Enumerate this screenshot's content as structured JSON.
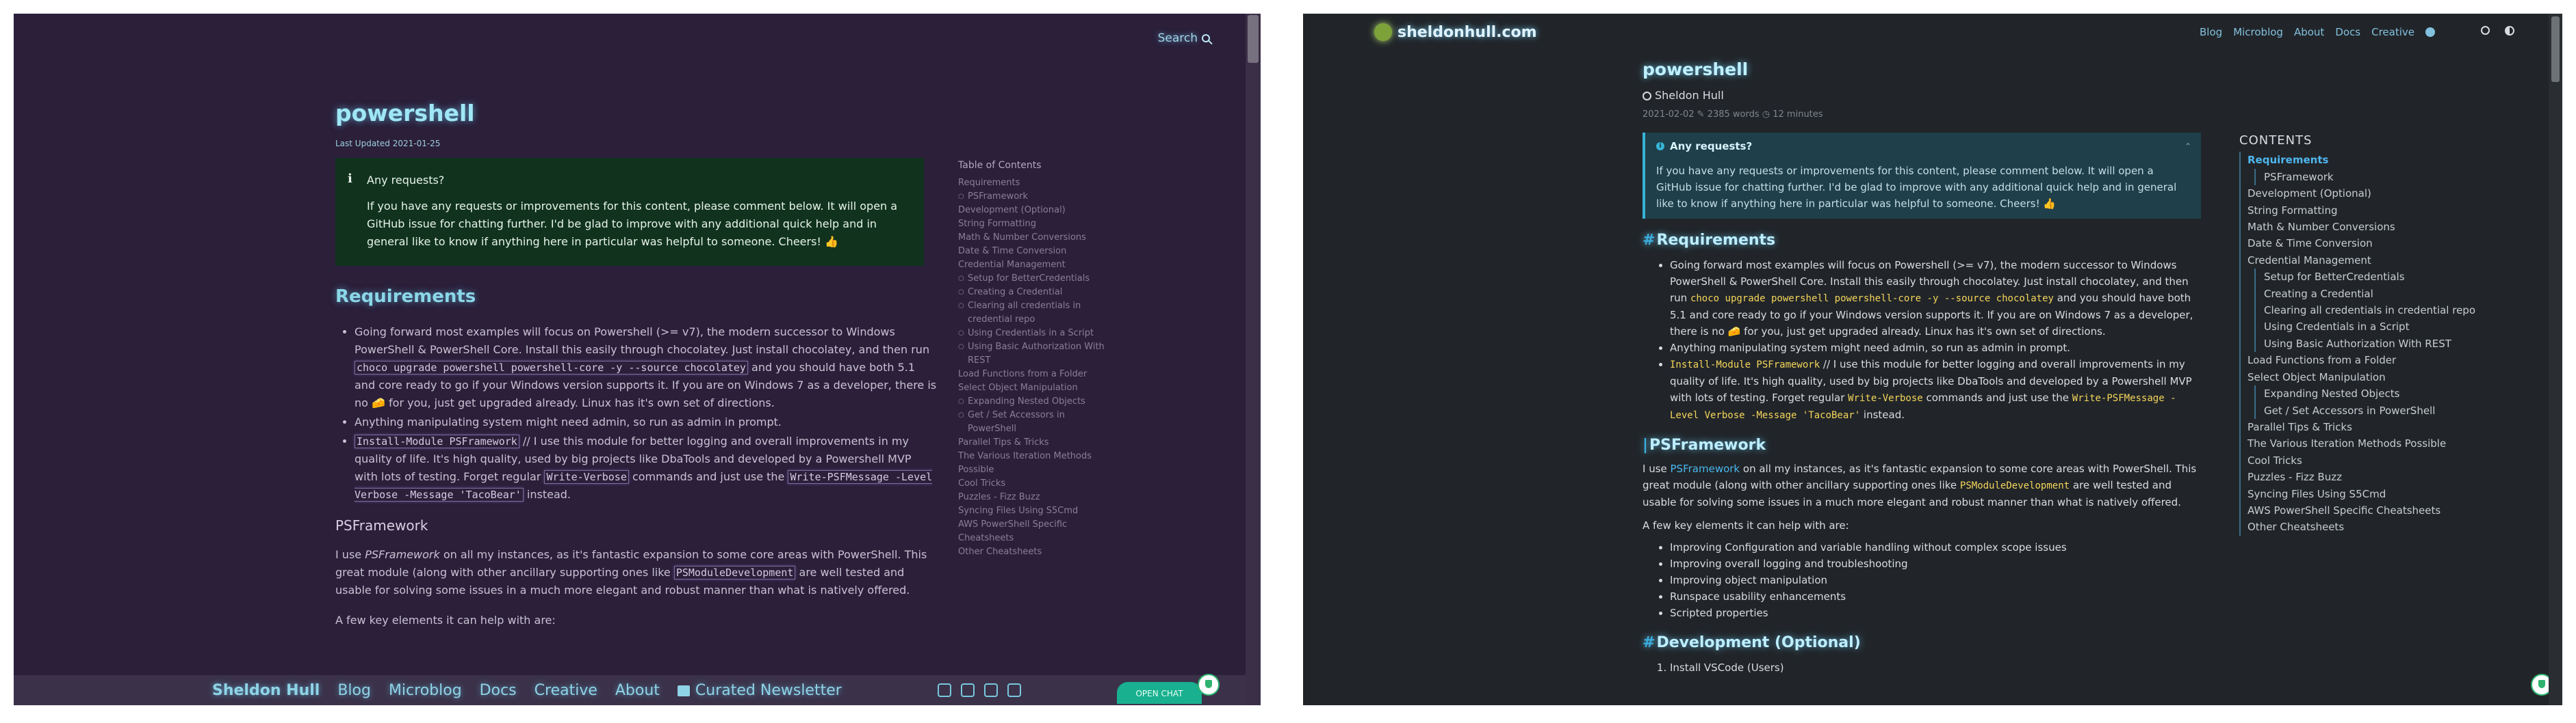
{
  "left": {
    "search_label": "Search",
    "title": "powershell",
    "last_updated": "Last Updated 2021-01-25",
    "callout": {
      "title": "Any requests?",
      "body": "If you have any requests or improvements for this content, please comment below. It will open a GitHub issue for chatting further. I'd be glad to improve with any additional quick help and in general like to know if anything here in particular was helpful to someone. Cheers! 👍"
    },
    "requirements_heading": "Requirements",
    "req1_a": "Going forward most examples will focus on Powershell (>= v7), the modern successor to Windows PowerShell & PowerShell Core. Install this easily through chocolatey. Just install chocolatey, and then run ",
    "req1_code": "choco upgrade powershell powershell-core -y --source chocolatey",
    "req1_b": " and you should have both 5.1 and core ready to go if your Windows version supports it. If you are on Windows 7 as a developer, there is no 🧀 for you, just get upgraded already. Linux has it's own set of directions.",
    "req2": "Anything manipulating system might need admin, so run as admin in prompt.",
    "req3_code": "Install-Module PSFramework",
    "req3_a": " // I use this module for better logging and overall improvements in my quality of life. It's high quality, used by big projects like DbaTools and developed by a Powershell MVP with lots of testing. Forget regular ",
    "req3_code2": "Write-Verbose",
    "req3_b": " commands and just use the ",
    "req3_code3": "Write-PSFMessage -Level Verbose -Message 'TacoBear'",
    "req3_c": " instead.",
    "psf_heading": "PSFramework",
    "psf_a": "I use ",
    "psf_em": "PSFramework",
    "psf_b": " on all my instances, as it's fantastic expansion to some core areas with PowerShell. This great module (along with other ancillary supporting ones like ",
    "psf_code": "PSModuleDevelopment",
    "psf_c": " are well tested and usable for solving some issues in a much more elegant and robust manner than what is natively offered.",
    "few_elements": "A few key elements it can help with are:",
    "toc_title": "Table of Contents",
    "toc": [
      {
        "label": "Requirements",
        "sub": false
      },
      {
        "label": "PSFramework",
        "sub": true
      },
      {
        "label": "Development (Optional)",
        "sub": false
      },
      {
        "label": "String Formatting",
        "sub": false
      },
      {
        "label": "Math & Number Conversions",
        "sub": false
      },
      {
        "label": "Date & Time Conversion",
        "sub": false
      },
      {
        "label": "Credential Management",
        "sub": false
      },
      {
        "label": "Setup for BetterCredentials",
        "sub": true
      },
      {
        "label": "Creating a Credential",
        "sub": true
      },
      {
        "label": "Clearing all credentials in credential repo",
        "sub": true
      },
      {
        "label": "Using Credentials in a Script",
        "sub": true
      },
      {
        "label": "Using Basic Authorization With REST",
        "sub": true
      },
      {
        "label": "Load Functions from a Folder",
        "sub": false
      },
      {
        "label": "Select Object Manipulation",
        "sub": false
      },
      {
        "label": "Expanding Nested Objects",
        "sub": true
      },
      {
        "label": "Get / Set Accessors in PowerShell",
        "sub": true
      },
      {
        "label": "Parallel Tips & Tricks",
        "sub": false
      },
      {
        "label": "The Various Iteration Methods Possible",
        "sub": false
      },
      {
        "label": "Cool Tricks",
        "sub": false
      },
      {
        "label": "Puzzles - Fizz Buzz",
        "sub": false
      },
      {
        "label": "Syncing Files Using S5Cmd",
        "sub": false
      },
      {
        "label": "AWS PowerShell Specific Cheatsheets",
        "sub": false
      },
      {
        "label": "Other Cheatsheets",
        "sub": false
      }
    ],
    "footer": {
      "brand": "Sheldon Hull",
      "links": [
        "Blog",
        "Microblog",
        "Docs",
        "Creative",
        "About"
      ],
      "newsletter": "Curated Newsletter",
      "open_chat": "OPEN CHAT"
    }
  },
  "right": {
    "logo": "sheldonhull.com",
    "nav": [
      "Blog",
      "Microblog",
      "About",
      "Docs",
      "Creative"
    ],
    "title": "powershell",
    "author": "Sheldon Hull",
    "meta": "2021-02-02 ✎ 2385 words  ◷ 12 minutes",
    "callout": {
      "title": "Any requests?",
      "body": "If you have any requests or improvements for this content, please comment below. It will open a GitHub issue for chatting further. I'd be glad to improve with any additional quick help and in general like to know if anything here in particular was helpful to someone. Cheers! 👍"
    },
    "requirements_heading": "Requirements",
    "req1_a": "Going forward most examples will focus on Powershell (>= v7), the modern successor to Windows PowerShell & PowerShell Core. Install this easily through chocolatey. Just install chocolatey, and then run ",
    "req1_code": "choco upgrade powershell powershell-core -y --source chocolatey",
    "req1_b": " and you should have both 5.1 and core ready to go if your Windows version supports it. If you are on Windows 7 as a developer, there is no 🧀 for you, just get upgraded already. Linux has it's own set of directions.",
    "req2": "Anything manipulating system might need admin, so run as admin in prompt.",
    "req3_code": "Install-Module PSFramework",
    "req3_a": " // I use this module for better logging and overall improvements in my quality of life. It's high quality, used by big projects like DbaTools and developed by a Powershell MVP with lots of testing. Forget regular ",
    "req3_code2": "Write-Verbose",
    "req3_b": " commands and just use the ",
    "req3_code3": "Write-PSFMessage -Level Verbose -Message 'TacoBear'",
    "req3_c": " instead.",
    "psf_heading": "PSFramework",
    "psf_a": "I use ",
    "psf_link": "PSFramework",
    "psf_b": " on all my instances, as it's fantastic expansion to some core areas with PowerShell. This great module (along with other ancillary supporting ones like ",
    "psf_code": "PSModuleDevelopment",
    "psf_c": " are well tested and usable for solving some issues in a much more elegant and robust manner than what is natively offered.",
    "few_elements": "A few key elements it can help with are:",
    "elements": [
      "Improving Configuration and variable handling without complex scope issues",
      "Improving overall logging and troubleshooting",
      "Improving object manipulation",
      "Runspace usability enhancements",
      "Scripted properties"
    ],
    "dev_heading": "Development (Optional)",
    "dev_step1": "Install VSCode (Users)",
    "toc_title": "CONTENTS",
    "toc": [
      {
        "label": "Requirements",
        "sub": false,
        "active": true
      },
      {
        "label": "PSFramework",
        "sub": true
      },
      {
        "label": "Development (Optional)",
        "sub": false
      },
      {
        "label": "String Formatting",
        "sub": false
      },
      {
        "label": "Math & Number Conversions",
        "sub": false
      },
      {
        "label": "Date & Time Conversion",
        "sub": false
      },
      {
        "label": "Credential Management",
        "sub": false
      },
      {
        "label": "Setup for BetterCredentials",
        "sub": true
      },
      {
        "label": "Creating a Credential",
        "sub": true
      },
      {
        "label": "Clearing all credentials in credential repo",
        "sub": true
      },
      {
        "label": "Using Credentials in a Script",
        "sub": true
      },
      {
        "label": "Using Basic Authorization With REST",
        "sub": true
      },
      {
        "label": "Load Functions from a Folder",
        "sub": false
      },
      {
        "label": "Select Object Manipulation",
        "sub": false
      },
      {
        "label": "Expanding Nested Objects",
        "sub": true
      },
      {
        "label": "Get / Set Accessors in PowerShell",
        "sub": true
      },
      {
        "label": "Parallel Tips & Tricks",
        "sub": false
      },
      {
        "label": "The Various Iteration Methods Possible",
        "sub": false
      },
      {
        "label": "Cool Tricks",
        "sub": false
      },
      {
        "label": "Puzzles - Fizz Buzz",
        "sub": false
      },
      {
        "label": "Syncing Files Using S5Cmd",
        "sub": false
      },
      {
        "label": "AWS PowerShell Specific Cheatsheets",
        "sub": false
      },
      {
        "label": "Other Cheatsheets",
        "sub": false
      }
    ]
  }
}
